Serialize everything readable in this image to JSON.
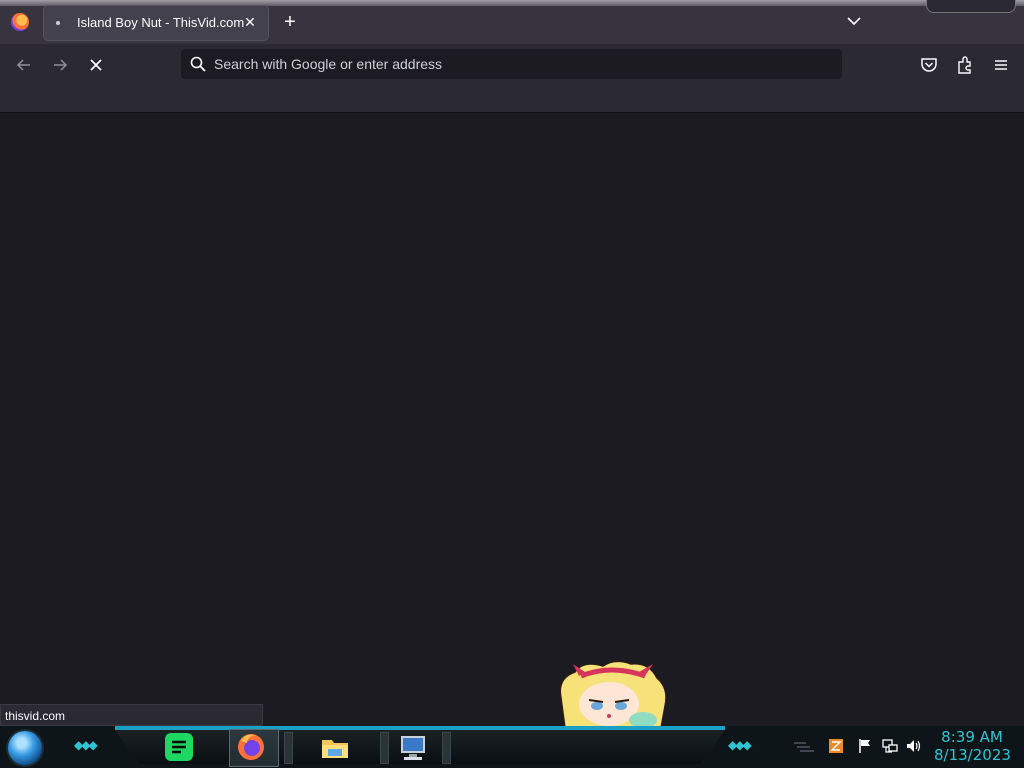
{
  "browser": {
    "tab": {
      "title": "Island Boy Nut - ThisVid.com",
      "close_glyph": "✕"
    },
    "new_tab_glyph": "+",
    "urlbar": {
      "placeholder": "Search with Google or enter address"
    },
    "status_url": "thisvid.com"
  },
  "taskbar": {
    "clock": {
      "time": "8:39 AM",
      "date": "8/13/2023"
    },
    "pinned": [
      "spotify-icon",
      "firefox-icon",
      "file-explorer-icon",
      "computer-icon"
    ],
    "accent_color": "#2ec4d4"
  },
  "colors": {
    "tabstrip": "#38343f",
    "toolbar": "#2b2a33",
    "content": "#1c1b22"
  }
}
